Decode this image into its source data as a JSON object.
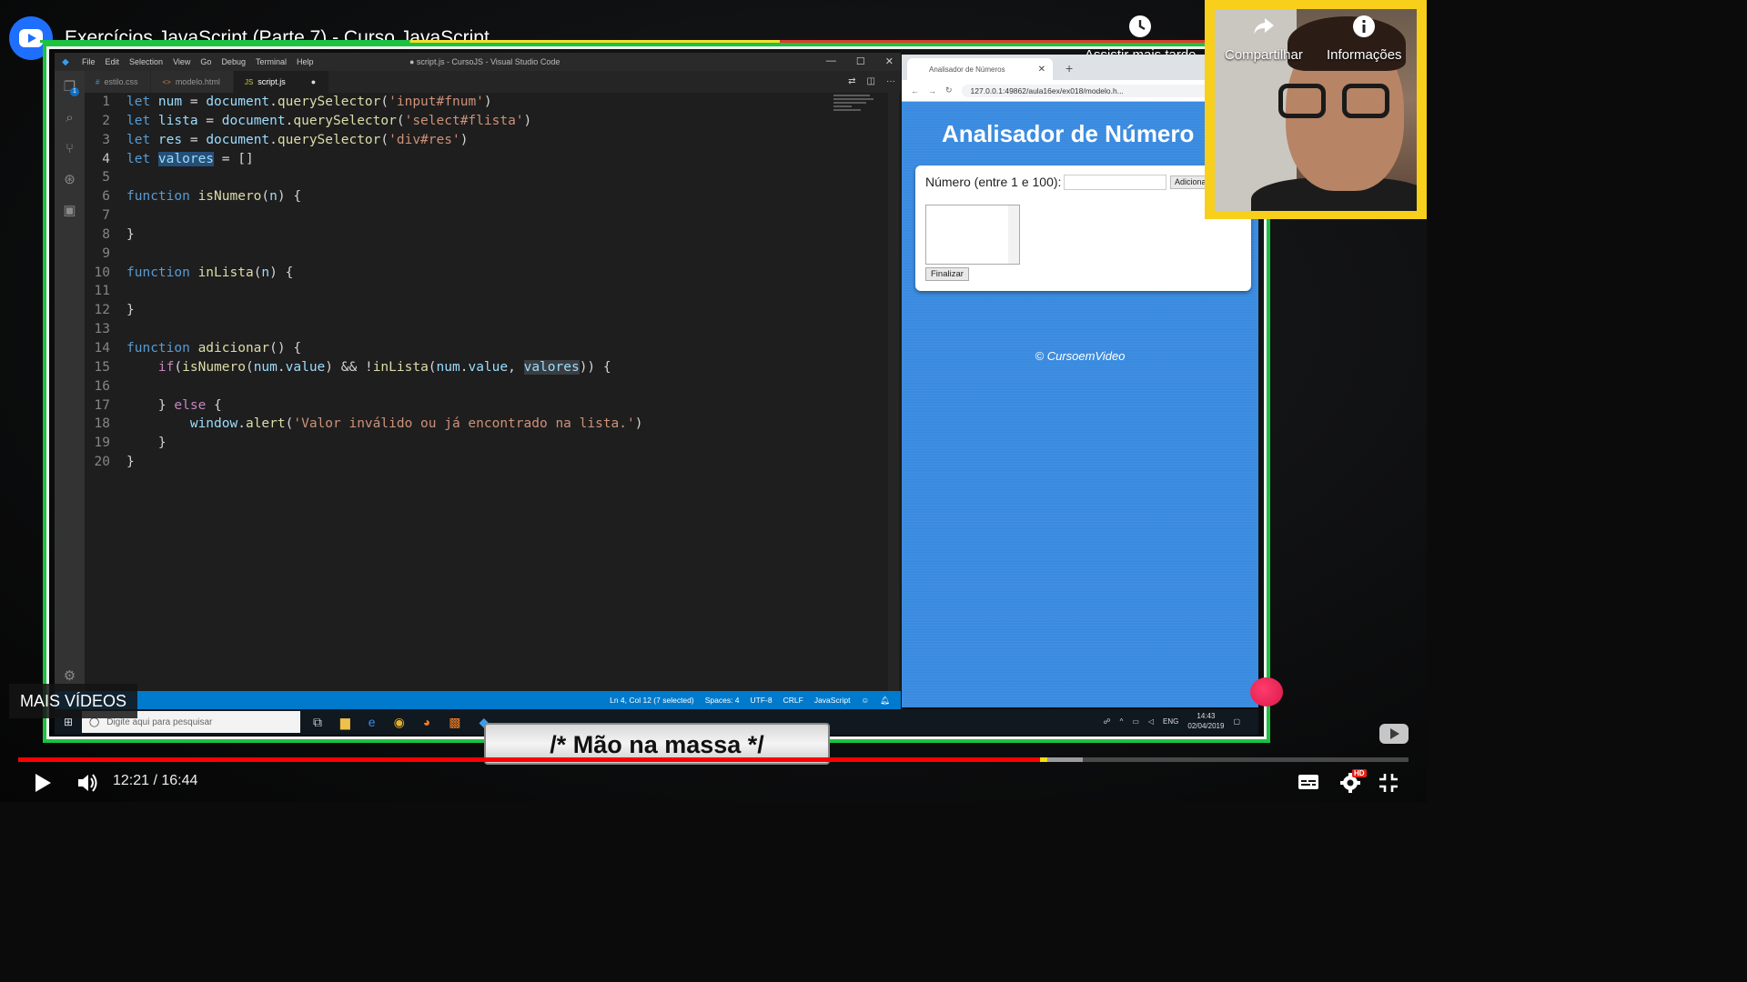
{
  "overlay": {
    "title": "Exercícios JavaScript (Parte 7) - Curso JavaScript",
    "actions": [
      {
        "label": "Assistir mais tarde",
        "icon": "clock-icon"
      },
      {
        "label": "Compartilhar",
        "icon": "share-icon"
      },
      {
        "label": "Informações",
        "icon": "info-icon"
      }
    ]
  },
  "vscode": {
    "menu": [
      "File",
      "Edit",
      "Selection",
      "View",
      "Go",
      "Debug",
      "Terminal",
      "Help"
    ],
    "window_title": "● script.js - CursoJS - Visual Studio Code",
    "tabs": [
      {
        "label": "estilo.css",
        "icon": "#"
      },
      {
        "label": "modelo.html",
        "icon": "<>"
      },
      {
        "label": "script.js",
        "icon": "JS",
        "active": true,
        "dirty": "●"
      }
    ],
    "badge": "1",
    "line_numbers": [
      "1",
      "2",
      "3",
      "4",
      "5",
      "6",
      "7",
      "8",
      "9",
      "10",
      "11",
      "12",
      "13",
      "14",
      "15",
      "16",
      "17",
      "18",
      "19",
      "20"
    ],
    "status": [
      "Ln 4, Col 12 (7 selected)",
      "Spaces: 4",
      "UTF-8",
      "CRLF",
      "JavaScript"
    ]
  },
  "code_text": {
    "l1": {
      "a": "let ",
      "b": "num",
      "c": " = ",
      "d": "document",
      "e": ".",
      "f": "querySelector",
      "g": "(",
      "h": "'input#fnum'",
      "i": ")"
    },
    "l2": {
      "a": "let ",
      "b": "lista",
      "c": " = ",
      "d": "document",
      "e": ".",
      "f": "querySelector",
      "g": "(",
      "h": "'select#flista'",
      "i": ")"
    },
    "l3": {
      "a": "let ",
      "b": "res",
      "c": " = ",
      "d": "document",
      "e": ".",
      "f": "querySelector",
      "g": "(",
      "h": "'div#res'",
      "i": ")"
    },
    "l4": {
      "a": "let ",
      "b": "valores",
      "c": " = []"
    },
    "l6": {
      "a": "function ",
      "b": "isNumero",
      "c": "(",
      "d": "n",
      "e": ") {"
    },
    "l8": {
      "a": "}"
    },
    "l10": {
      "a": "function ",
      "b": "inLista",
      "c": "(",
      "d": "n",
      "e": ") {"
    },
    "l12": {
      "a": "}"
    },
    "l14": {
      "a": "function ",
      "b": "adicionar",
      "c": "() {"
    },
    "l15": {
      "a": "    ",
      "b": "if",
      "c": "(",
      "d": "isNumero",
      "e": "(",
      "f": "num",
      "g": ".",
      "h": "value",
      "i": ") && !",
      "j": "inLista",
      "k": "(",
      "l": "num",
      "m": ".",
      "n": "value",
      "o": ", ",
      "p": "valores",
      "q": ")) {"
    },
    "l17": {
      "a": "    } ",
      "b": "else",
      "c": " {"
    },
    "l18": {
      "a": "        ",
      "b": "window",
      "c": ".",
      "d": "alert",
      "e": "(",
      "f": "'Valor inválido ou já encontrado na lista.'",
      "g": ")"
    },
    "l19": {
      "a": "    }"
    },
    "l20": {
      "a": "}"
    }
  },
  "browser": {
    "tab_title": "Analisador de Números",
    "url": "127.0.0.1:49862/aula16ex/ex018/modelo.h...",
    "heading": "Analisador de Número",
    "label": "Número (entre 1 e 100):",
    "add_button": "Adicionar",
    "finish_button": "Finalizar",
    "footer": "© CursoemVideo"
  },
  "taskbar": {
    "search_placeholder": "Digite aqui para pesquisar",
    "lang": "ENG",
    "time": "14:43",
    "date": "02/04/2019"
  },
  "player": {
    "mais_videos": "MAIS VÍDEOS",
    "subtitle": "/* Mão na massa */",
    "time_display": "12:21 / 16:44",
    "progress_played": 0.7366,
    "progress_buffered": 0.766,
    "hd_badge": "HD"
  },
  "colors": {
    "vscode_bg": "#1e1e1e",
    "vscode_status": "#007acc",
    "browser_page": "#3a8be0",
    "progress_red": "#ff0000",
    "frame_green": "#1bc341",
    "webcam_yellow": "#f8d01b"
  }
}
